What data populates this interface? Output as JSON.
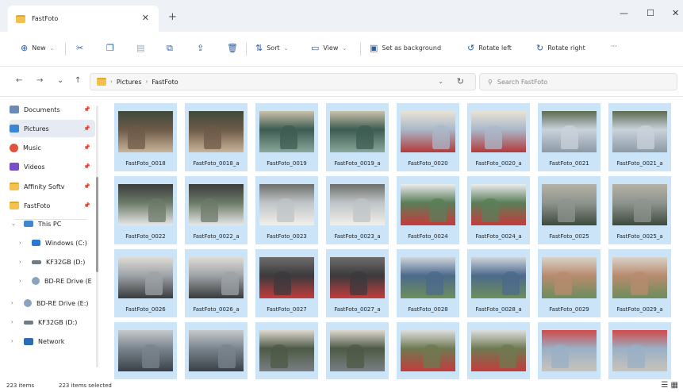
{
  "tab": {
    "title": "FastFoto",
    "close_glyph": "✕",
    "new_tab_glyph": "+"
  },
  "window": {
    "minimize_glyph": "—",
    "maximize_glyph": "☐",
    "close_glyph": "✕"
  },
  "toolbar": {
    "new_label": "New",
    "sort_label": "Sort",
    "view_label": "View",
    "set_background_label": "Set as background",
    "rotate_left_label": "Rotate left",
    "rotate_right_label": "Rotate right",
    "more_glyph": "···"
  },
  "address": {
    "crumbs": [
      "Pictures",
      "FastFoto"
    ]
  },
  "search": {
    "placeholder": "Search FastFoto"
  },
  "sidebar": {
    "quick": [
      {
        "label": "Documents",
        "icon": "document-icon"
      },
      {
        "label": "Pictures",
        "icon": "pictures-icon"
      },
      {
        "label": "Music",
        "icon": "music-icon"
      },
      {
        "label": "Videos",
        "icon": "videos-icon"
      },
      {
        "label": "Affinity Softv",
        "icon": "folder-icon"
      },
      {
        "label": "FastFoto",
        "icon": "folder-icon"
      }
    ],
    "tree": [
      {
        "label": "This PC",
        "icon": "pc-icon"
      },
      {
        "label": "Windows (C:)",
        "icon": "windows-drive-icon"
      },
      {
        "label": "KF32GB (D:)",
        "icon": "usb-drive-icon"
      },
      {
        "label": "BD-RE Drive (E",
        "icon": "disc-drive-icon"
      },
      {
        "label": "BD-RE Drive (E:)",
        "icon": "disc-drive-icon"
      },
      {
        "label": "KF32GB (D:)",
        "icon": "usb-drive-icon"
      },
      {
        "label": "Network",
        "icon": "network-icon"
      }
    ]
  },
  "files": [
    "FastFoto_0018",
    "FastFoto_0018_a",
    "FastFoto_0019",
    "FastFoto_0019_a",
    "FastFoto_0020",
    "FastFoto_0020_a",
    "FastFoto_0021",
    "FastFoto_0021_a",
    "FastFoto_0022",
    "FastFoto_0022_a",
    "FastFoto_0023",
    "FastFoto_0023_a",
    "FastFoto_0024",
    "FastFoto_0024_a",
    "FastFoto_0025",
    "FastFoto_0025_a",
    "FastFoto_0026",
    "FastFoto_0026_a",
    "FastFoto_0027",
    "FastFoto_0027_a",
    "FastFoto_0028",
    "FastFoto_0028_a",
    "FastFoto_0029",
    "FastFoto_0029_a",
    "",
    "",
    "",
    "",
    "",
    "",
    "",
    ""
  ],
  "status": {
    "item_count": "223 items",
    "selected_count": "223 items selected"
  },
  "colors": {
    "selection": "#cce4f7",
    "accent": "#2b5ea8"
  }
}
